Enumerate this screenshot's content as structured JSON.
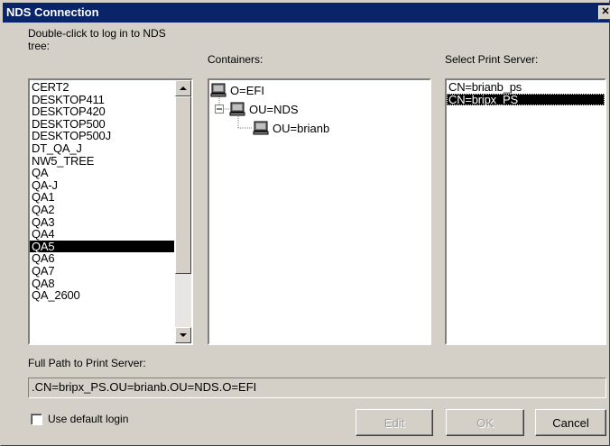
{
  "window": {
    "title": "NDS Connection",
    "close_symbol": "✕"
  },
  "tree_list": {
    "label": "Double-click to log in to NDS\ntree:",
    "items": [
      "CERT2",
      "DESKTOP411",
      "DESKTOP420",
      "DESKTOP500",
      "DESKTOP500J",
      "DT_QA_J",
      "NW5_TREE",
      "QA",
      "QA-J",
      "QA1",
      "QA2",
      "QA3",
      "QA4",
      "QA5",
      "QA6",
      "QA7",
      "QA8",
      "QA_2600"
    ],
    "selected": "QA5"
  },
  "containers": {
    "label": "Containers:",
    "nodes": [
      {
        "label": "O=EFI",
        "icon": "computer-icon",
        "level": 0
      },
      {
        "label": "OU=NDS",
        "icon": "computer-icon",
        "level": 1,
        "expander": "−"
      },
      {
        "label": "OU=brianb",
        "icon": "computer-icon",
        "level": 2
      }
    ]
  },
  "print_servers": {
    "label": "Select Print Server:",
    "items": [
      "CN=brianb_ps",
      "CN=bripx_PS"
    ],
    "selected": "CN=bripx_PS"
  },
  "full_path": {
    "label": "Full Path to Print Server:",
    "value": ".CN=bripx_PS.OU=brianb.OU=NDS.O=EFI"
  },
  "options": {
    "use_default_login_label": "Use default login",
    "use_default_login_checked": false
  },
  "buttons": {
    "edit": "Edit",
    "ok": "OK",
    "cancel": "Cancel"
  },
  "colors": {
    "face": "#d4d0c8",
    "titlebar": "#0a246a",
    "selection": "#000000"
  }
}
